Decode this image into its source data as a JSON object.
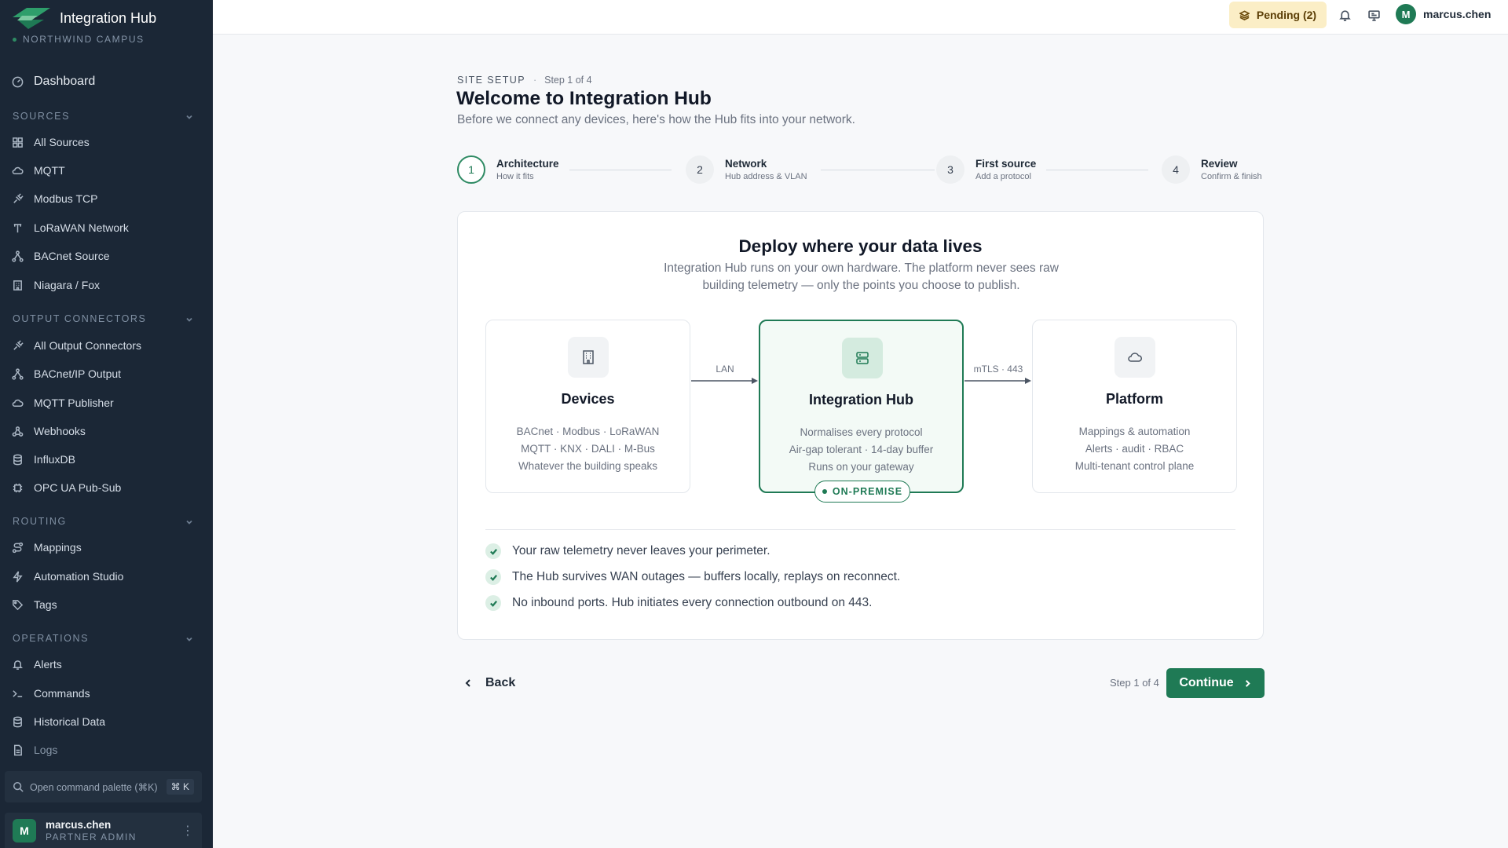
{
  "brand": {
    "title": "Integration Hub",
    "campus": "NORTHWIND CAMPUS"
  },
  "sidebar": {
    "dashboard": "Dashboard",
    "sections": [
      {
        "title": "SOURCES",
        "items": [
          "All Sources",
          "MQTT",
          "Modbus TCP",
          "LoRaWAN Network",
          "BACnet Source",
          "Niagara / Fox"
        ]
      },
      {
        "title": "OUTPUT CONNECTORS",
        "items": [
          "All Output Connectors",
          "BACnet/IP Output",
          "MQTT Publisher",
          "Webhooks",
          "InfluxDB",
          "OPC UA Pub-Sub"
        ]
      },
      {
        "title": "ROUTING",
        "items": [
          "Mappings",
          "Automation Studio",
          "Tags"
        ]
      },
      {
        "title": "OPERATIONS",
        "items": [
          "Alerts",
          "Commands",
          "Historical Data",
          "Logs"
        ]
      }
    ],
    "command_palette": {
      "placeholder": "Open command palette (⌘K)",
      "shortcut": "⌘ K"
    },
    "user": {
      "initial": "M",
      "name": "marcus.chen",
      "role": "PARTNER ADMIN"
    }
  },
  "topbar": {
    "pending_label": "Pending (2)",
    "user": {
      "initial": "M",
      "name": "marcus.chen"
    }
  },
  "header": {
    "breadcrumb": "SITE SETUP",
    "step_indicator": "Step 1 of 4",
    "title": "Welcome to Integration Hub",
    "subtitle": "Before we connect any devices, here's how the Hub fits into your network."
  },
  "steps": [
    {
      "num": "1",
      "title": "Architecture",
      "desc": "How it fits",
      "active": true
    },
    {
      "num": "2",
      "title": "Network",
      "desc": "Hub address & VLAN",
      "active": false
    },
    {
      "num": "3",
      "title": "First source",
      "desc": "Add a protocol",
      "active": false
    },
    {
      "num": "4",
      "title": "Review",
      "desc": "Confirm & finish",
      "active": false
    }
  ],
  "card": {
    "title": "Deploy where your data lives",
    "desc_line1": "Integration Hub runs on your own hardware. The platform never sees raw",
    "desc_line2": "building telemetry — only the points you choose to publish.",
    "nodes": {
      "devices": {
        "title": "Devices",
        "lines": [
          "BACnet · Modbus · LoRaWAN",
          "MQTT · KNX · DALI · M-Bus",
          "Whatever the building speaks"
        ]
      },
      "hub": {
        "title": "Integration Hub",
        "lines": [
          "Normalises every protocol",
          "Air-gap tolerant · 14-day buffer",
          "Runs on your gateway"
        ],
        "badge": "ON-PREMISE"
      },
      "platform": {
        "title": "Platform",
        "lines": [
          "Mappings & automation",
          "Alerts · audit · RBAC",
          "Multi-tenant control plane"
        ]
      }
    },
    "links": {
      "left": "LAN",
      "right": "mTLS · 443"
    },
    "checks": [
      "Your raw telemetry never leaves your perimeter.",
      "The Hub survives WAN outages — buffers locally, replays on reconnect.",
      "No inbound ports. Hub initiates every connection outbound on 443."
    ]
  },
  "footer": {
    "back_label": "Back",
    "step_label": "Step 1 of 4",
    "continue_label": "Continue"
  },
  "colors": {
    "sidebar_bg": "#1b2736",
    "accent": "#1f7a55",
    "pending_bg": "#fbeec6"
  }
}
